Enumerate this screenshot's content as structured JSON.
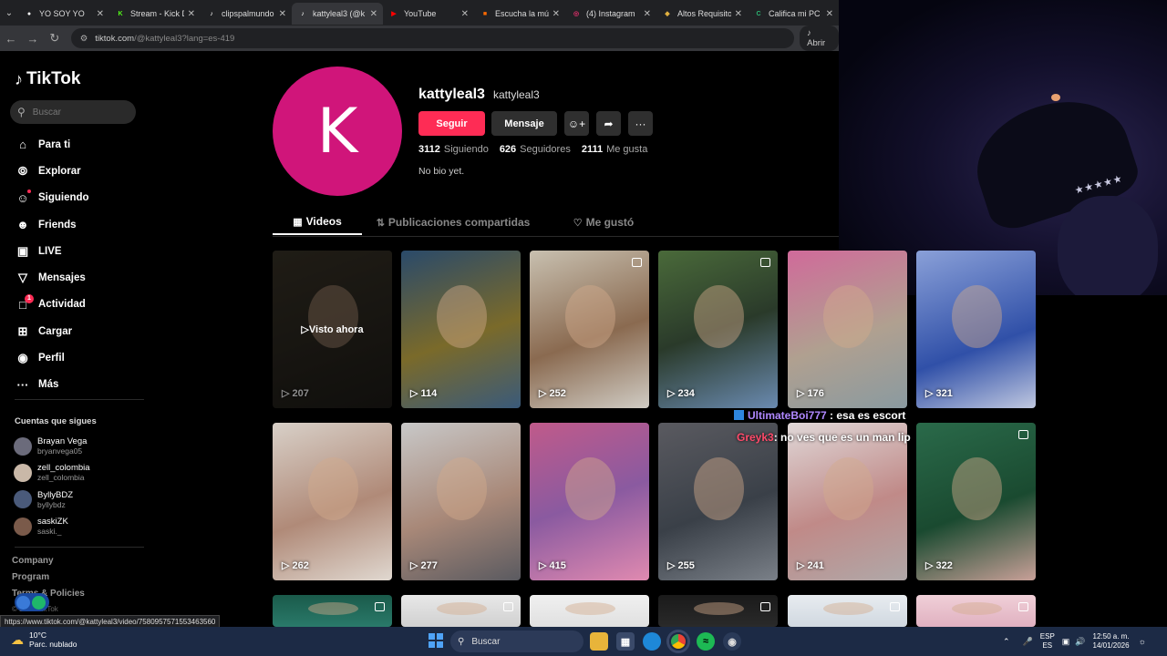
{
  "browser": {
    "tabs": [
      {
        "label": "YO SOY YO",
        "color": "#ffffff",
        "glyph": "●",
        "active": false
      },
      {
        "label": "Stream - Kick D",
        "color": "#53fc18",
        "glyph": "K",
        "active": false
      },
      {
        "label": "clipspalmundo",
        "color": "#ffffff",
        "glyph": "♪",
        "active": false
      },
      {
        "label": "kattyleal3 (@k",
        "color": "#ffffff",
        "glyph": "♪",
        "active": true
      },
      {
        "label": "YouTube",
        "color": "#ff0000",
        "glyph": "▶",
        "active": false
      },
      {
        "label": "Escucha la mús",
        "color": "#ff6a00",
        "glyph": "■",
        "active": false
      },
      {
        "label": "(4) Instagram",
        "color": "#e1306c",
        "glyph": "◎",
        "active": false
      },
      {
        "label": "Altos Requisito",
        "color": "#e0b040",
        "glyph": "◆",
        "active": false
      },
      {
        "label": "Califica mi PC",
        "color": "#2bb673",
        "glyph": "C",
        "active": false
      }
    ],
    "url_host": "tiktok.com",
    "url_path": "/@kattyleal3?lang=es-419",
    "open_in_app": "Abrir"
  },
  "sidebar": {
    "logo": "TikTok",
    "search_placeholder": "Buscar",
    "nav": [
      {
        "label": "Para ti",
        "icon": "home-icon",
        "glyph": "⌂"
      },
      {
        "label": "Explorar",
        "icon": "compass-icon",
        "glyph": "⦾"
      },
      {
        "label": "Siguiendo",
        "icon": "following-icon",
        "glyph": "☺"
      },
      {
        "label": "Friends",
        "icon": "friends-icon",
        "glyph": "☻"
      },
      {
        "label": "LIVE",
        "icon": "live-icon",
        "glyph": "▣"
      },
      {
        "label": "Mensajes",
        "icon": "send-icon",
        "glyph": "▽"
      },
      {
        "label": "Actividad",
        "icon": "activity-icon",
        "glyph": "□",
        "badge": "1"
      },
      {
        "label": "Cargar",
        "icon": "upload-icon",
        "glyph": "⊞"
      },
      {
        "label": "Perfil",
        "icon": "profile-icon",
        "glyph": "◉"
      },
      {
        "label": "Más",
        "icon": "more-icon",
        "glyph": "···"
      }
    ],
    "following_title": "Cuentas que sigues",
    "following": [
      {
        "name": "Brayan Vega",
        "user": "bryanvega05",
        "color": "#6b6b7b"
      },
      {
        "name": "zell_colombia",
        "user": "zell_colombia",
        "color": "#c9b8a8"
      },
      {
        "name": "ByllyBDZ",
        "user": "byllybdz",
        "color": "#4a5a7a"
      },
      {
        "name": "saskiZK",
        "user": "saski._",
        "color": "#7a5a4a"
      }
    ],
    "links": [
      "Company",
      "Program",
      "Terms & Policies"
    ],
    "copyright": "© 2026 TikTok"
  },
  "profile": {
    "initial": "K",
    "avatar_color": "#d0157a",
    "name": "kattyleal3",
    "username": "kattyleal3",
    "follow_label": "Seguir",
    "message_label": "Mensaje",
    "following_count": "3112",
    "following_label": "Siguiendo",
    "followers_count": "626",
    "followers_label": "Seguidores",
    "likes_count": "2111",
    "likes_label": "Me gusta",
    "bio": "No bio yet.",
    "tabs": [
      "Videos",
      "Publicaciones compartidas",
      "Me gustó"
    ],
    "watched_label": "Visto ahora"
  },
  "videos": [
    {
      "views": "207",
      "bg": "linear-gradient(160deg,#3a3428,#1e1c18)",
      "watched": true,
      "pinned": false
    },
    {
      "views": "114",
      "bg": "linear-gradient(160deg,#2a4a6a,#7a6a2a 55%,#3a5a7a)",
      "watched": false,
      "pinned": false
    },
    {
      "views": "252",
      "bg": "linear-gradient(160deg,#c8c0b0,#8a6a50 55%,#d0ccc4)",
      "watched": false,
      "pinned": true
    },
    {
      "views": "234",
      "bg": "linear-gradient(160deg,#4a6a3a,#2a3a2a 50%,#6a8ab0)",
      "watched": false,
      "pinned": true
    },
    {
      "views": "176",
      "bg": "linear-gradient(160deg,#d06a9a,#b0a090 55%,#8a9aa0)",
      "watched": false,
      "pinned": false
    },
    {
      "views": "321",
      "bg": "linear-gradient(160deg,#8aa0d8,#3050a8 60%,#c0c8e0)",
      "watched": false,
      "pinned": false
    },
    {
      "views": "262",
      "bg": "linear-gradient(160deg,#d8d0c8,#b08a78 55%,#e0d8d0)",
      "watched": false,
      "pinned": false
    },
    {
      "views": "277",
      "bg": "linear-gradient(160deg,#c8c8c8,#a88878 55%,#5a5a60)",
      "watched": false,
      "pinned": false
    },
    {
      "views": "415",
      "bg": "linear-gradient(160deg,#c05a8a,#8a5aa0 50%,#e08ab0)",
      "watched": false,
      "pinned": false
    },
    {
      "views": "255",
      "bg": "linear-gradient(160deg,#5a5a60,#3a4048 55%,#7a8088)",
      "watched": false,
      "pinned": false
    },
    {
      "views": "241",
      "bg": "linear-gradient(160deg,#e0d8d8,#c08a88 55%,#b0a8a8)",
      "watched": false,
      "pinned": false
    },
    {
      "views": "322",
      "bg": "linear-gradient(160deg,#2a6a4a,#1a4a30 55%,#c8a098)",
      "watched": false,
      "pinned": true
    },
    {
      "views": "",
      "bg": "linear-gradient(180deg,#1a5a4a,#2a7a6a)",
      "watched": false,
      "pinned": true
    },
    {
      "views": "",
      "bg": "linear-gradient(180deg,#e8e8e8,#d0d0d0)",
      "watched": false,
      "pinned": true
    },
    {
      "views": "",
      "bg": "linear-gradient(180deg,#f0f0f0,#e0e0e0)",
      "watched": false,
      "pinned": false
    },
    {
      "views": "",
      "bg": "linear-gradient(180deg,#1a1a1a,#2a2a2a)",
      "watched": false,
      "pinned": true
    },
    {
      "views": "",
      "bg": "linear-gradient(180deg,#e8ecf0,#d0d8e0)",
      "watched": false,
      "pinned": true
    },
    {
      "views": "",
      "bg": "linear-gradient(180deg,#f0d0d8,#e0b0c0)",
      "watched": false,
      "pinned": true
    }
  ],
  "chat": [
    {
      "user": "UltimateBoi777",
      "text": ": esa es escort"
    },
    {
      "user": "Greyk3",
      "text": ": no ves que es un man lip"
    }
  ],
  "status_url": "https://www.tiktok.com/@kattyleal3/video/7580957571553463560",
  "taskbar": {
    "temp": "10°C",
    "weather": "Parc. nublado",
    "search": "Buscar",
    "lang1": "ESP",
    "lang2": "ES",
    "time": "12:50 a. m.",
    "date": "14/01/2026"
  }
}
